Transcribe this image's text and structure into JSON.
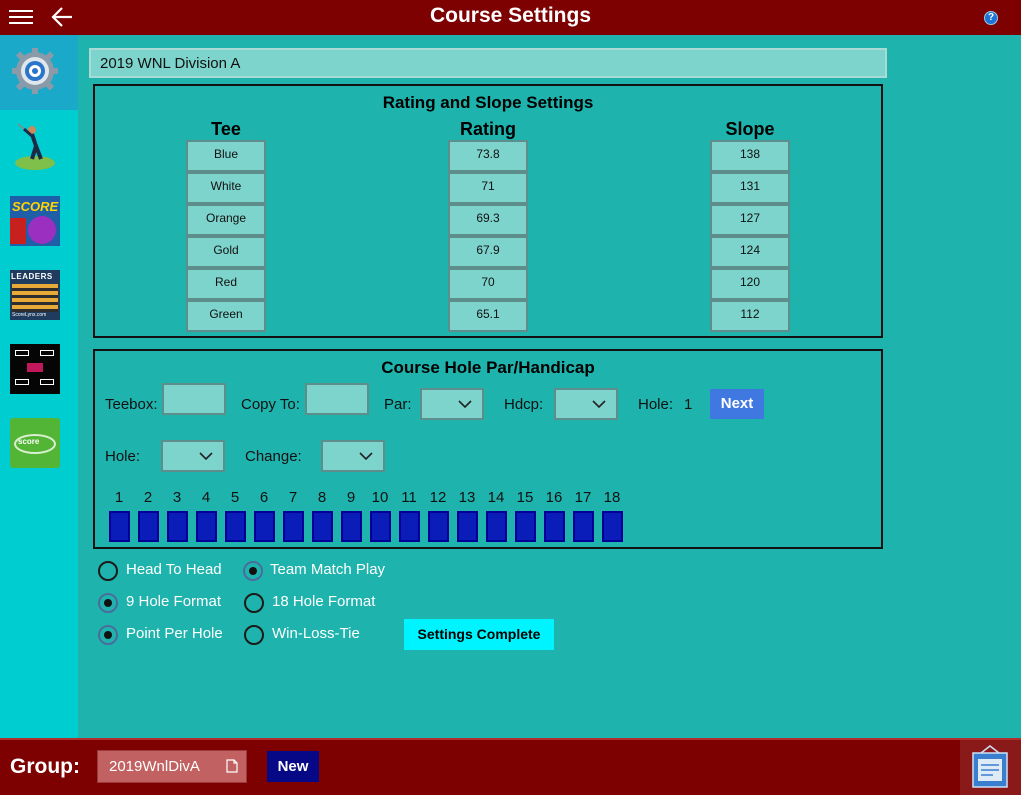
{
  "app": {
    "title": "Course Settings"
  },
  "course": {
    "name": "2019 WNL Division A"
  },
  "rating_panel": {
    "title": "Rating and Slope Settings",
    "columns": [
      "Tee",
      "Rating",
      "Slope"
    ],
    "rows": [
      {
        "tee": "Blue",
        "rating": "73.8",
        "slope": "138"
      },
      {
        "tee": "White",
        "rating": "71",
        "slope": "131"
      },
      {
        "tee": "Orange",
        "rating": "69.3",
        "slope": "127"
      },
      {
        "tee": "Gold",
        "rating": "67.9",
        "slope": "124"
      },
      {
        "tee": "Red",
        "rating": "70",
        "slope": "120"
      },
      {
        "tee": "Green",
        "rating": "65.1",
        "slope": "112"
      }
    ]
  },
  "hole_panel": {
    "title": "Course Hole Par/Handicap",
    "teebox_label": "Teebox:",
    "copyto_label": "Copy To:",
    "par_label": "Par:",
    "hdcp_label": "Hdcp:",
    "hole_label": "Hole:",
    "hole_value": "1",
    "next_label": "Next",
    "hole_select_label": "Hole:",
    "change_label": "Change:",
    "holes": [
      "1",
      "2",
      "3",
      "4",
      "5",
      "6",
      "7",
      "8",
      "9",
      "10",
      "11",
      "12",
      "13",
      "14",
      "15",
      "16",
      "17",
      "18"
    ]
  },
  "options": {
    "head_to_head": {
      "label": "Head To Head",
      "checked": false
    },
    "team_match_play": {
      "label": "Team Match Play",
      "checked": true
    },
    "nine_hole": {
      "label": "9 Hole Format",
      "checked": true
    },
    "eighteen_hole": {
      "label": "18 Hole Format",
      "checked": false
    },
    "point_per_hole": {
      "label": "Point Per Hole",
      "checked": true
    },
    "win_loss_tie": {
      "label": "Win-Loss-Tie",
      "checked": false
    },
    "complete_label": "Settings Complete"
  },
  "bottom": {
    "group_label": "Group:",
    "group_value": "2019WnlDivA",
    "new_label": "New"
  },
  "icons": {
    "sidebar": [
      "settings-gear-icon",
      "golfer-icon",
      "score-app-icon",
      "leaders-app-icon",
      "bracket-app-icon",
      "golf-scorecard-icon"
    ],
    "review": "write-a-review-icon"
  },
  "colors": {
    "titlebar": "#7e0102",
    "sidebar": "#00cdd0",
    "main_bg": "#1fb3ad",
    "hole_box": "#0b1db8",
    "complete_button": "#00f4ff",
    "next_button": "#3f78e0"
  }
}
